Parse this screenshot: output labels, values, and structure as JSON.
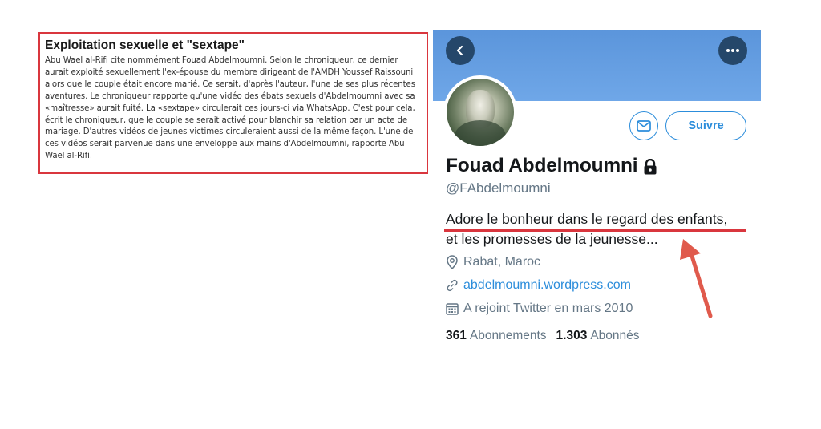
{
  "article": {
    "title": "Exploitation sexuelle et \"sextape\"",
    "body": "Abu Wael al-Rifi cite nommément Fouad Abdelmoumni. Selon le chroniqueur, ce dernier aurait exploité sexuellement l'ex-épouse du membre dirigeant de l'AMDH Youssef Raissouni alors que le couple était encore marié. Ce serait, d'après l'auteur, l'une de ses plus récentes aventures. Le chroniqueur rapporte qu'une vidéo des ébats sexuels d'Abdelmoumni avec sa «maîtresse» aurait fuité. La «sextape» circulerait ces jours-ci via WhatsApp. C'est pour cela, écrit le chroniqueur, que le couple se serait activé pour blanchir sa relation par un acte de mariage. D'autres vidéos de jeunes victimes circuleraient aussi de la même façon. L'une de ces vidéos serait parvenue dans une enveloppe aux mains d'Abdelmoumni, rapporte Abu Wael al-Rifi."
  },
  "profile": {
    "name": "Fouad Abdelmoumni",
    "handle": "@FAbdelmoumni",
    "follow_label": "Suivre",
    "bio_line1": "Adore le bonheur dans le regard des enfants,",
    "bio_line2": "et les promesses de la jeunesse...",
    "location": "Rabat, Maroc",
    "website": "abdelmoumni.wordpress.com",
    "joined": "A rejoint Twitter en mars 2010",
    "following_count": "361",
    "following_label": "Abonnements",
    "followers_count": "1.303",
    "followers_label": "Abonnés",
    "icons": {
      "back": "chevron-left-icon",
      "more": "more-horizontal-icon",
      "message": "envelope-icon",
      "protected": "lock-icon",
      "location": "location-pin-icon",
      "link": "link-icon",
      "calendar": "calendar-icon"
    }
  },
  "colors": {
    "banner": "#5b95db",
    "accent": "#2c8ddb",
    "highlight_red": "#d9363e",
    "dark_button": "#25476a"
  }
}
